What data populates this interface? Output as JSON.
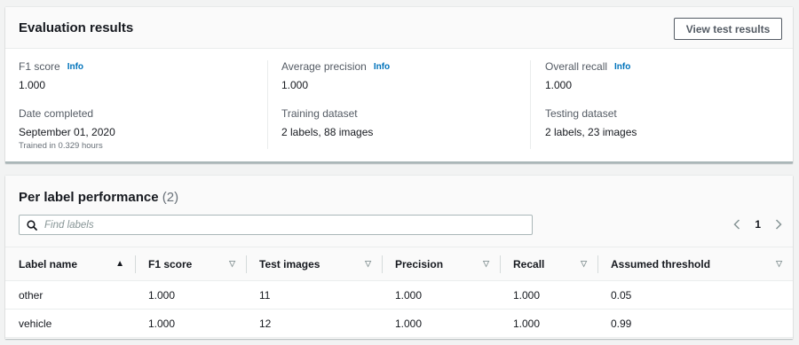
{
  "evaluation": {
    "title": "Evaluation results",
    "view_button": "View test results",
    "metrics": [
      {
        "label": "F1 score",
        "info": "Info",
        "value": "1.000"
      },
      {
        "label": "Average precision",
        "info": "Info",
        "value": "1.000"
      },
      {
        "label": "Overall recall",
        "info": "Info",
        "value": "1.000"
      }
    ],
    "details": [
      {
        "label": "Date completed",
        "value": "September 01, 2020",
        "sub": "Trained in 0.329 hours"
      },
      {
        "label": "Training dataset",
        "value": "2 labels, 88 images"
      },
      {
        "label": "Testing dataset",
        "value": "2 labels, 23 images"
      }
    ]
  },
  "performance": {
    "title": "Per label performance",
    "count": "(2)",
    "search_placeholder": "Find labels",
    "page": "1",
    "columns": [
      "Label name",
      "F1 score",
      "Test images",
      "Precision",
      "Recall",
      "Assumed threshold"
    ],
    "rows": [
      [
        "other",
        "1.000",
        "11",
        "1.000",
        "1.000",
        "0.05"
      ],
      [
        "vehicle",
        "1.000",
        "12",
        "1.000",
        "1.000",
        "0.99"
      ]
    ]
  }
}
